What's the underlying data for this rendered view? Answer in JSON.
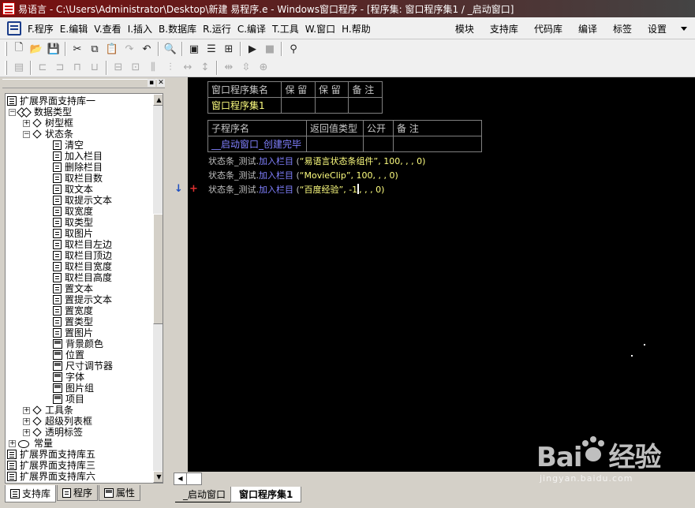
{
  "window": {
    "title": "易语言 - C:\\Users\\Administrator\\Desktop\\新建 易程序.e - Windows窗口程序 - [程序集: 窗口程序集1 / _启动窗口]"
  },
  "menu": {
    "items": [
      "F.程序",
      "E.编辑",
      "V.查看",
      "I.插入",
      "B.数据库",
      "R.运行",
      "C.编译",
      "T.工具",
      "W.窗口",
      "H.帮助"
    ],
    "right_items": [
      "模块",
      "支持库",
      "代码库",
      "编译",
      "标签",
      "设置"
    ]
  },
  "tree": {
    "items": [
      "扩展界面支持库一",
      "数据类型",
      "树型框",
      "状态条",
      "清空",
      "加入栏目",
      "删除栏目",
      "取栏目数",
      "取文本",
      "取提示文本",
      "取宽度",
      "取类型",
      "取图片",
      "取栏目左边",
      "取栏目顶边",
      "取栏目宽度",
      "取栏目高度",
      "置文本",
      "置提示文本",
      "置宽度",
      "置类型",
      "置图片",
      "背景颜色",
      "位置",
      "尺寸调节器",
      "字体",
      "图片组",
      "项目",
      "工具条",
      "超级列表框",
      "透明标签",
      "常量",
      "扩展界面支持库五",
      "扩展界面支持库三",
      "扩展界面支持库六"
    ]
  },
  "bottom_tabs": [
    "支持库",
    "程序",
    "属性"
  ],
  "editor": {
    "assembly_table": {
      "headers": [
        "窗口程序集名",
        "保 留",
        "保 留",
        "备 注"
      ],
      "values": [
        "窗口程序集1",
        "",
        "",
        ""
      ]
    },
    "sub_table": {
      "headers": [
        "子程序名",
        "返回值类型",
        "公开",
        "备 注"
      ],
      "values": [
        "__启动窗口_创建完毕",
        "",
        "",
        ""
      ]
    },
    "lines": [
      {
        "obj": "状态条_测试.",
        "method": "加入栏目",
        "open": " (",
        "str": "“易语言状态条组件”",
        "rest": ", 100, , , 0)"
      },
      {
        "obj": "状态条_测试.",
        "method": "加入栏目",
        "open": " (",
        "str": "“MovieClip”",
        "rest": ", 100, , , 0)"
      },
      {
        "obj": "状态条_测试.",
        "method": "加入栏目",
        "open": " (",
        "str": "“百度经验”",
        "rest_a": ", -1",
        "rest_b": ", , , 0)"
      }
    ],
    "gutter_marks": [
      "↓",
      "+"
    ]
  },
  "doc_tabs": [
    "_启动窗口",
    "窗口程序集1"
  ],
  "watermark": {
    "brand": "Bai",
    "brand2": "经验",
    "url": "jingyan.baidu.com"
  }
}
